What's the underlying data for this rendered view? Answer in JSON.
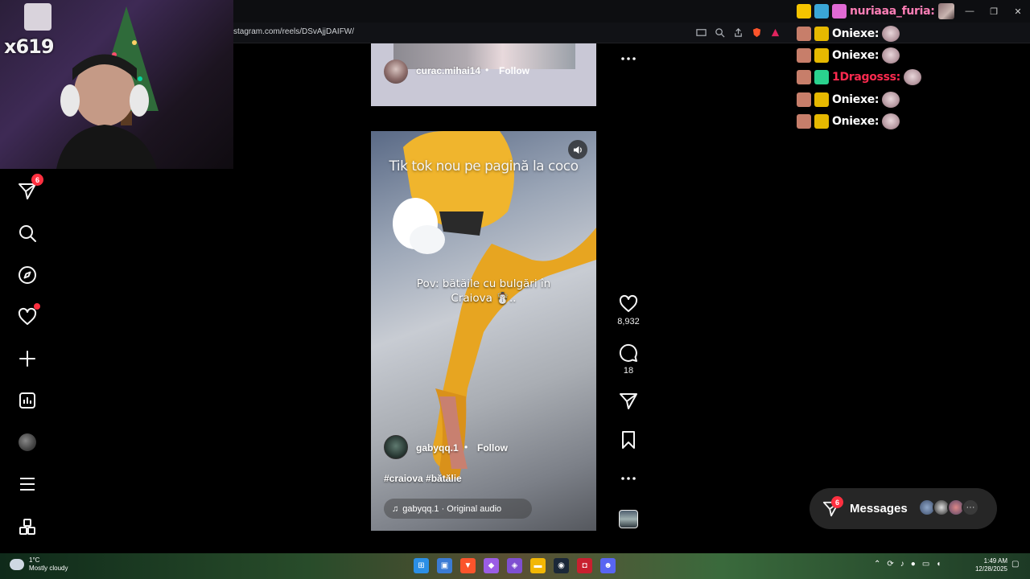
{
  "browser": {
    "url": "stagram.com/reels/DSvAjjDAIFW/"
  },
  "webcam": {
    "label": "x619"
  },
  "nav": {
    "messages_badge": "6",
    "items": [
      "messages-icon",
      "search-icon",
      "explore-icon",
      "notifications-icon",
      "create-icon",
      "dashboard-icon",
      "profile-avatar",
      "menu-icon",
      "apps-icon"
    ]
  },
  "prev_reel": {
    "username": "curac.mihai14",
    "dot": "•",
    "follow": "Follow"
  },
  "reel": {
    "overlay_top": "Tik tok nou pe pagină la coco",
    "overlay_mid": "Pov: bătăile cu bulgări în Craiova ☃️..",
    "username": "gabyqq.1",
    "dot": "•",
    "follow": "Follow",
    "tags": "#craiova #bătălie",
    "audio": "gabyqq.1 · Original audio"
  },
  "actions": {
    "likes": "8,932",
    "comments": "18"
  },
  "chat": {
    "messages": [
      {
        "name": "nuriaaa_furia:",
        "color": "#ff7eb6"
      },
      {
        "name": "Oniexe:",
        "color": "#ffffff"
      },
      {
        "name": "Oniexe:",
        "color": "#ffffff"
      },
      {
        "name": "1Dragosss:",
        "color": "#ff2a4f"
      },
      {
        "name": "Oniexe:",
        "color": "#ffffff"
      },
      {
        "name": "Oniexe:",
        "color": "#ffffff"
      }
    ]
  },
  "messages_pill": {
    "label": "Messages",
    "badge": "6",
    "more": "···"
  },
  "taskbar": {
    "temp": "1°C",
    "condition": "Mostly cloudy",
    "time": "1:49 AM",
    "date": "12/28/2025"
  },
  "colors": {
    "badge_red": "#ff3040",
    "pill_bg": "#262626"
  }
}
